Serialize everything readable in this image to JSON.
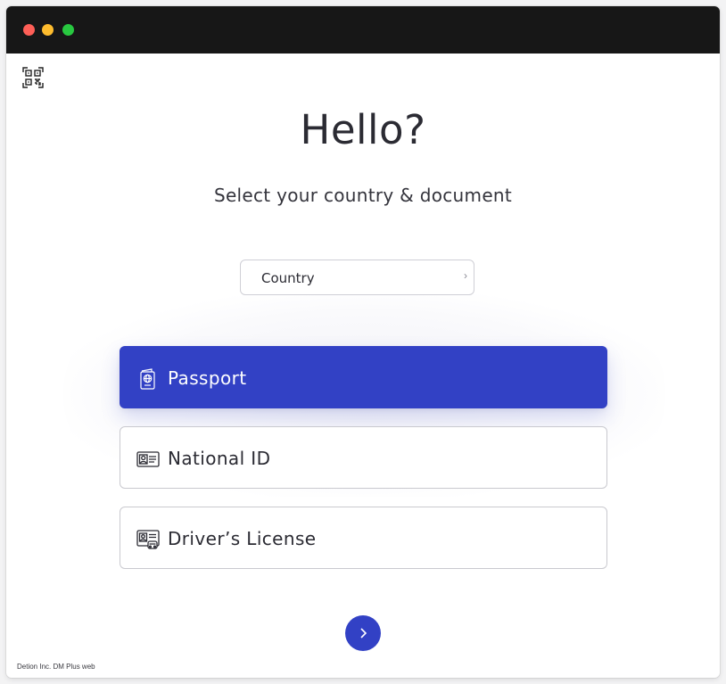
{
  "window": {
    "controls": [
      "close",
      "minimize",
      "zoom"
    ]
  },
  "toolbar": {
    "qr_icon": "qr-code-icon"
  },
  "header": {
    "title": "Hello?",
    "subtitle": "Select your country & document"
  },
  "country": {
    "label": "Country",
    "chevron": "›"
  },
  "documents": [
    {
      "label": "Passport",
      "icon": "passport-icon",
      "selected": true
    },
    {
      "label": "National ID",
      "icon": "national-id-icon",
      "selected": false
    },
    {
      "label": "Driver’s License",
      "icon": "drivers-license-icon",
      "selected": false
    }
  ],
  "next": {
    "icon": "chevron-right-icon"
  },
  "footer": {
    "text": "Detion Inc. DM Plus web"
  },
  "colors": {
    "accent": "#3241c5",
    "titlebar": "#171717",
    "text": "#2b2b33"
  }
}
